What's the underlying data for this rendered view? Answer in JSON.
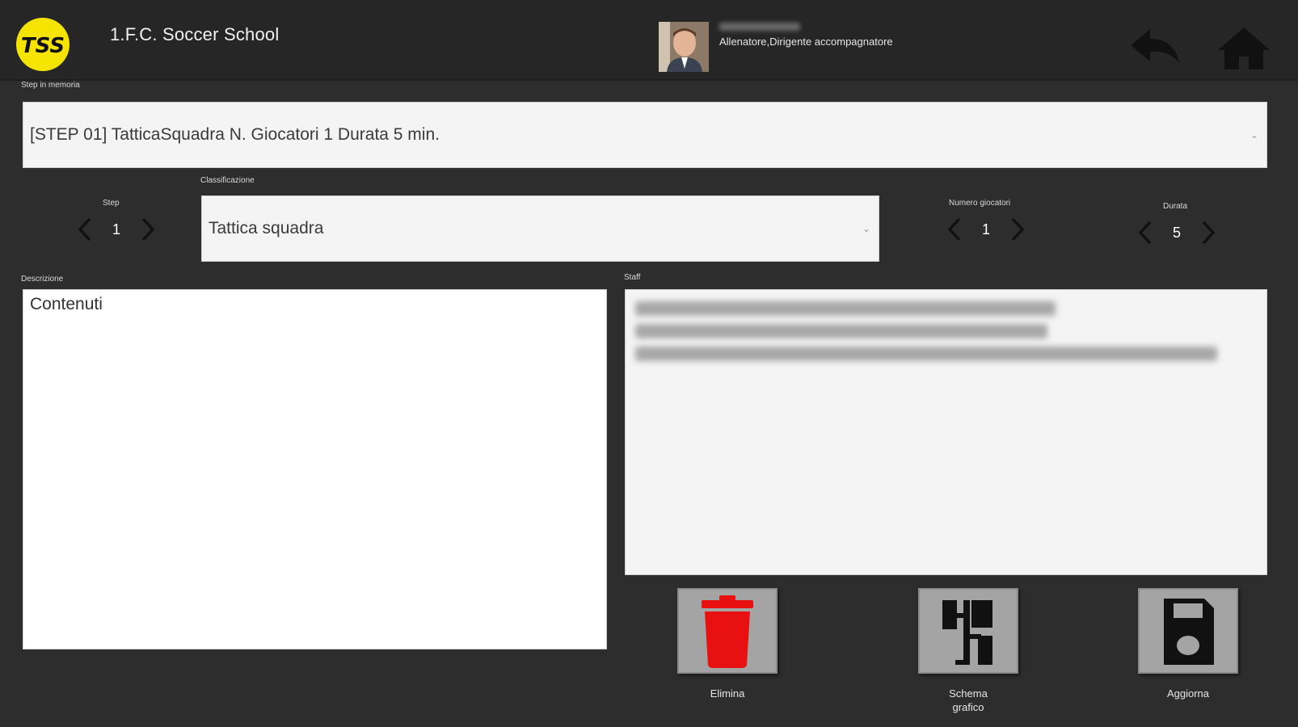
{
  "header": {
    "title": "1.F.C. Soccer School",
    "logo_text": "TSS",
    "user_role": "Allenatore,Dirigente accompagnatore"
  },
  "step_memory": {
    "label": "Step in memoria",
    "selected": "[STEP 01] TatticaSquadra N. Giocatori 1 Durata 5 min."
  },
  "step": {
    "label": "Step",
    "value": "1"
  },
  "classification": {
    "label": "Classificazione",
    "selected": "Tattica squadra"
  },
  "players": {
    "label": "Numero giocatori",
    "value": "1"
  },
  "duration": {
    "label": "Durata",
    "value": "5"
  },
  "description": {
    "label": "Descrizione",
    "value": "Contenuti"
  },
  "staff": {
    "label": "Staff"
  },
  "actions": {
    "delete_label": "Elimina",
    "schema_label_line1": "Schema",
    "schema_label_line2": "grafico",
    "update_label": "Aggiorna"
  },
  "colors": {
    "background": "#2d2d2d",
    "header": "#262626",
    "logo_yellow": "#f5e400",
    "delete_red": "#e81010",
    "button_gray": "#a4a4a4"
  },
  "icons": {
    "back": "back-arrow-icon",
    "home": "home-icon",
    "delete": "trash-icon",
    "schema": "schema-diagram-icon",
    "update": "floppy-disk-icon"
  }
}
